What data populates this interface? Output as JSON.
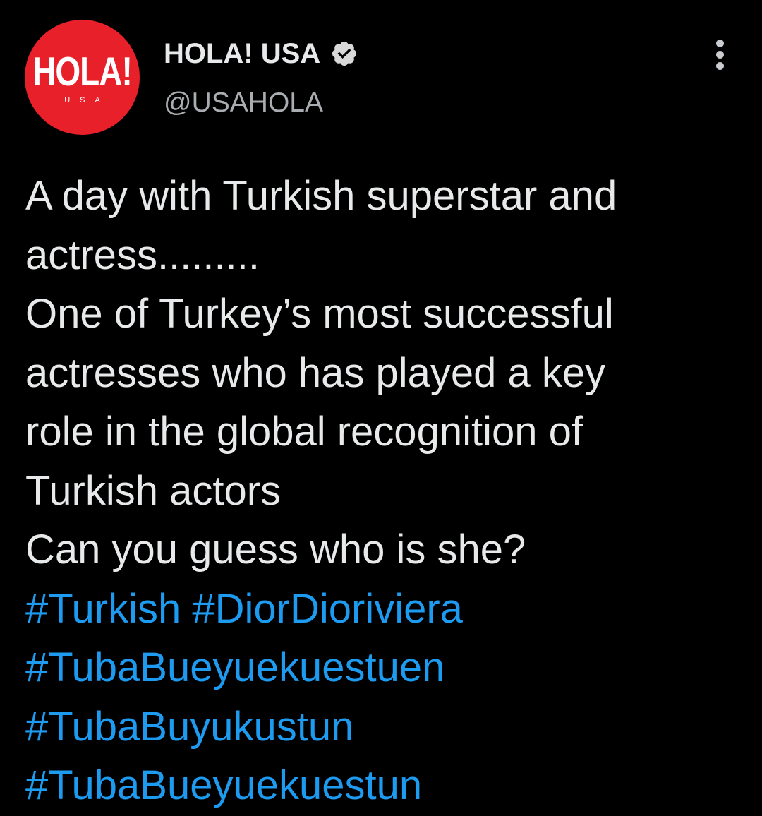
{
  "account": {
    "display_name": "HOLA! USA",
    "handle": "@USAHOLA",
    "verified": true,
    "avatar": {
      "logo_text": "HOLA!",
      "sub_text": "USA",
      "background_color": "#e8202a"
    }
  },
  "menu": {
    "icon": "more-vertical-icon"
  },
  "tweet": {
    "lines": [
      "A day with Turkish superstar and",
      "actress.........",
      "One of Turkey’s most successful",
      "actresses who has played a key",
      "role in the global recognition of",
      "Turkish actors",
      "Can you guess who is she?"
    ],
    "hashtags": [
      "#Turkish",
      "#DiorDioriviera",
      "#TubaBueyuekuestuen",
      "#TubaBuyukustun",
      "#TubaBueyuekuestun"
    ]
  },
  "colors": {
    "background": "#000000",
    "text": "#e7e9ea",
    "secondary_text": "#a9adb1",
    "link": "#1d9bf0",
    "verified_badge": "#d9d9d9"
  }
}
